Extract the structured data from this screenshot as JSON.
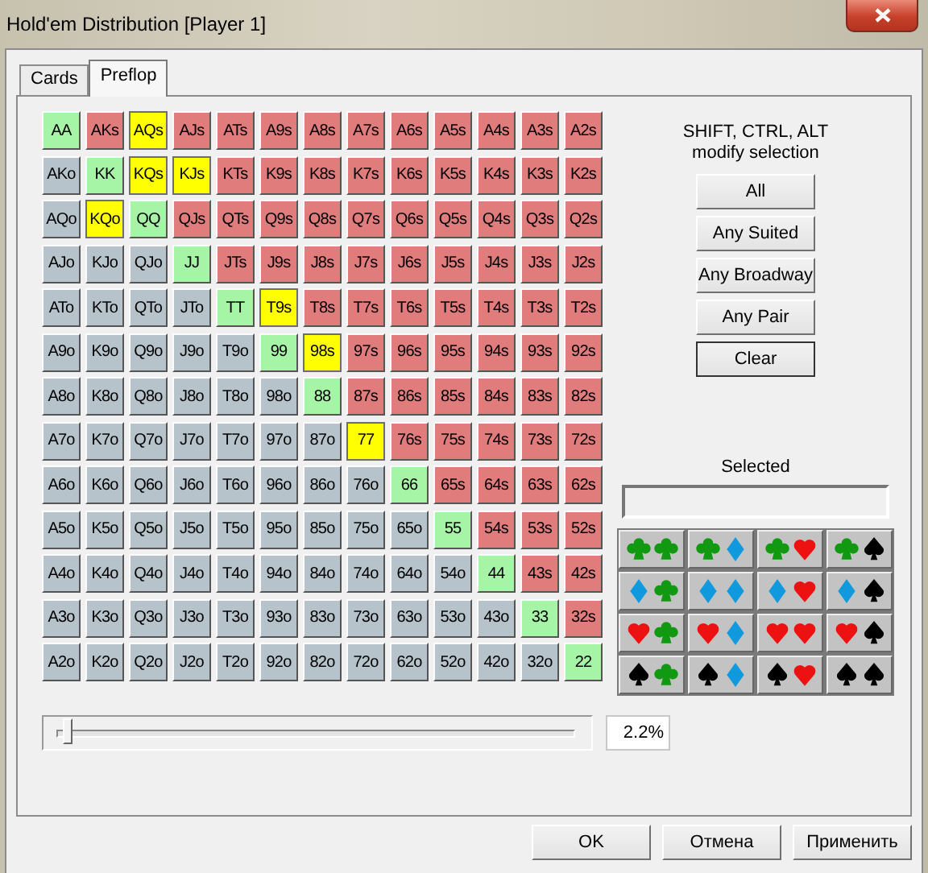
{
  "window": {
    "title": "Hold'em Distribution [Player 1]"
  },
  "tabs": [
    {
      "label": "Cards",
      "selected": false
    },
    {
      "label": "Preflop",
      "selected": true
    }
  ],
  "grid": {
    "rows": [
      [
        {
          "label": "AA",
          "kind": "pair",
          "selected": false
        },
        {
          "label": "AKs",
          "kind": "suited",
          "selected": false
        },
        {
          "label": "AQs",
          "kind": "suited",
          "selected": true
        },
        {
          "label": "AJs",
          "kind": "suited",
          "selected": false
        },
        {
          "label": "ATs",
          "kind": "suited",
          "selected": false
        },
        {
          "label": "A9s",
          "kind": "suited",
          "selected": false
        },
        {
          "label": "A8s",
          "kind": "suited",
          "selected": false
        },
        {
          "label": "A7s",
          "kind": "suited",
          "selected": false
        },
        {
          "label": "A6s",
          "kind": "suited",
          "selected": false
        },
        {
          "label": "A5s",
          "kind": "suited",
          "selected": false
        },
        {
          "label": "A4s",
          "kind": "suited",
          "selected": false
        },
        {
          "label": "A3s",
          "kind": "suited",
          "selected": false
        },
        {
          "label": "A2s",
          "kind": "suited",
          "selected": false
        }
      ],
      [
        {
          "label": "AKo",
          "kind": "offsuit",
          "selected": false
        },
        {
          "label": "KK",
          "kind": "pair",
          "selected": false
        },
        {
          "label": "KQs",
          "kind": "suited",
          "selected": true
        },
        {
          "label": "KJs",
          "kind": "suited",
          "selected": true
        },
        {
          "label": "KTs",
          "kind": "suited",
          "selected": false
        },
        {
          "label": "K9s",
          "kind": "suited",
          "selected": false
        },
        {
          "label": "K8s",
          "kind": "suited",
          "selected": false
        },
        {
          "label": "K7s",
          "kind": "suited",
          "selected": false
        },
        {
          "label": "K6s",
          "kind": "suited",
          "selected": false
        },
        {
          "label": "K5s",
          "kind": "suited",
          "selected": false
        },
        {
          "label": "K4s",
          "kind": "suited",
          "selected": false
        },
        {
          "label": "K3s",
          "kind": "suited",
          "selected": false
        },
        {
          "label": "K2s",
          "kind": "suited",
          "selected": false
        }
      ],
      [
        {
          "label": "AQo",
          "kind": "offsuit",
          "selected": false
        },
        {
          "label": "KQo",
          "kind": "offsuit",
          "selected": true
        },
        {
          "label": "QQ",
          "kind": "pair",
          "selected": false
        },
        {
          "label": "QJs",
          "kind": "suited",
          "selected": false
        },
        {
          "label": "QTs",
          "kind": "suited",
          "selected": false
        },
        {
          "label": "Q9s",
          "kind": "suited",
          "selected": false
        },
        {
          "label": "Q8s",
          "kind": "suited",
          "selected": false
        },
        {
          "label": "Q7s",
          "kind": "suited",
          "selected": false
        },
        {
          "label": "Q6s",
          "kind": "suited",
          "selected": false
        },
        {
          "label": "Q5s",
          "kind": "suited",
          "selected": false
        },
        {
          "label": "Q4s",
          "kind": "suited",
          "selected": false
        },
        {
          "label": "Q3s",
          "kind": "suited",
          "selected": false
        },
        {
          "label": "Q2s",
          "kind": "suited",
          "selected": false
        }
      ],
      [
        {
          "label": "AJo",
          "kind": "offsuit",
          "selected": false
        },
        {
          "label": "KJo",
          "kind": "offsuit",
          "selected": false
        },
        {
          "label": "QJo",
          "kind": "offsuit",
          "selected": false
        },
        {
          "label": "JJ",
          "kind": "pair",
          "selected": false
        },
        {
          "label": "JTs",
          "kind": "suited",
          "selected": false
        },
        {
          "label": "J9s",
          "kind": "suited",
          "selected": false
        },
        {
          "label": "J8s",
          "kind": "suited",
          "selected": false
        },
        {
          "label": "J7s",
          "kind": "suited",
          "selected": false
        },
        {
          "label": "J6s",
          "kind": "suited",
          "selected": false
        },
        {
          "label": "J5s",
          "kind": "suited",
          "selected": false
        },
        {
          "label": "J4s",
          "kind": "suited",
          "selected": false
        },
        {
          "label": "J3s",
          "kind": "suited",
          "selected": false
        },
        {
          "label": "J2s",
          "kind": "suited",
          "selected": false
        }
      ],
      [
        {
          "label": "ATo",
          "kind": "offsuit",
          "selected": false
        },
        {
          "label": "KTo",
          "kind": "offsuit",
          "selected": false
        },
        {
          "label": "QTo",
          "kind": "offsuit",
          "selected": false
        },
        {
          "label": "JTo",
          "kind": "offsuit",
          "selected": false
        },
        {
          "label": "TT",
          "kind": "pair",
          "selected": false
        },
        {
          "label": "T9s",
          "kind": "suited",
          "selected": true
        },
        {
          "label": "T8s",
          "kind": "suited",
          "selected": false
        },
        {
          "label": "T7s",
          "kind": "suited",
          "selected": false
        },
        {
          "label": "T6s",
          "kind": "suited",
          "selected": false
        },
        {
          "label": "T5s",
          "kind": "suited",
          "selected": false
        },
        {
          "label": "T4s",
          "kind": "suited",
          "selected": false
        },
        {
          "label": "T3s",
          "kind": "suited",
          "selected": false
        },
        {
          "label": "T2s",
          "kind": "suited",
          "selected": false
        }
      ],
      [
        {
          "label": "A9o",
          "kind": "offsuit",
          "selected": false
        },
        {
          "label": "K9o",
          "kind": "offsuit",
          "selected": false
        },
        {
          "label": "Q9o",
          "kind": "offsuit",
          "selected": false
        },
        {
          "label": "J9o",
          "kind": "offsuit",
          "selected": false
        },
        {
          "label": "T9o",
          "kind": "offsuit",
          "selected": false
        },
        {
          "label": "99",
          "kind": "pair",
          "selected": false
        },
        {
          "label": "98s",
          "kind": "suited",
          "selected": true
        },
        {
          "label": "97s",
          "kind": "suited",
          "selected": false
        },
        {
          "label": "96s",
          "kind": "suited",
          "selected": false
        },
        {
          "label": "95s",
          "kind": "suited",
          "selected": false
        },
        {
          "label": "94s",
          "kind": "suited",
          "selected": false
        },
        {
          "label": "93s",
          "kind": "suited",
          "selected": false
        },
        {
          "label": "92s",
          "kind": "suited",
          "selected": false
        }
      ],
      [
        {
          "label": "A8o",
          "kind": "offsuit",
          "selected": false
        },
        {
          "label": "K8o",
          "kind": "offsuit",
          "selected": false
        },
        {
          "label": "Q8o",
          "kind": "offsuit",
          "selected": false
        },
        {
          "label": "J8o",
          "kind": "offsuit",
          "selected": false
        },
        {
          "label": "T8o",
          "kind": "offsuit",
          "selected": false
        },
        {
          "label": "98o",
          "kind": "offsuit",
          "selected": false
        },
        {
          "label": "88",
          "kind": "pair",
          "selected": false
        },
        {
          "label": "87s",
          "kind": "suited",
          "selected": false
        },
        {
          "label": "86s",
          "kind": "suited",
          "selected": false
        },
        {
          "label": "85s",
          "kind": "suited",
          "selected": false
        },
        {
          "label": "84s",
          "kind": "suited",
          "selected": false
        },
        {
          "label": "83s",
          "kind": "suited",
          "selected": false
        },
        {
          "label": "82s",
          "kind": "suited",
          "selected": false
        }
      ],
      [
        {
          "label": "A7o",
          "kind": "offsuit",
          "selected": false
        },
        {
          "label": "K7o",
          "kind": "offsuit",
          "selected": false
        },
        {
          "label": "Q7o",
          "kind": "offsuit",
          "selected": false
        },
        {
          "label": "J7o",
          "kind": "offsuit",
          "selected": false
        },
        {
          "label": "T7o",
          "kind": "offsuit",
          "selected": false
        },
        {
          "label": "97o",
          "kind": "offsuit",
          "selected": false
        },
        {
          "label": "87o",
          "kind": "offsuit",
          "selected": false
        },
        {
          "label": "77",
          "kind": "pair",
          "selected": true
        },
        {
          "label": "76s",
          "kind": "suited",
          "selected": false
        },
        {
          "label": "75s",
          "kind": "suited",
          "selected": false
        },
        {
          "label": "74s",
          "kind": "suited",
          "selected": false
        },
        {
          "label": "73s",
          "kind": "suited",
          "selected": false
        },
        {
          "label": "72s",
          "kind": "suited",
          "selected": false
        }
      ],
      [
        {
          "label": "A6o",
          "kind": "offsuit",
          "selected": false
        },
        {
          "label": "K6o",
          "kind": "offsuit",
          "selected": false
        },
        {
          "label": "Q6o",
          "kind": "offsuit",
          "selected": false
        },
        {
          "label": "J6o",
          "kind": "offsuit",
          "selected": false
        },
        {
          "label": "T6o",
          "kind": "offsuit",
          "selected": false
        },
        {
          "label": "96o",
          "kind": "offsuit",
          "selected": false
        },
        {
          "label": "86o",
          "kind": "offsuit",
          "selected": false
        },
        {
          "label": "76o",
          "kind": "offsuit",
          "selected": false
        },
        {
          "label": "66",
          "kind": "pair",
          "selected": false
        },
        {
          "label": "65s",
          "kind": "suited",
          "selected": false
        },
        {
          "label": "64s",
          "kind": "suited",
          "selected": false
        },
        {
          "label": "63s",
          "kind": "suited",
          "selected": false
        },
        {
          "label": "62s",
          "kind": "suited",
          "selected": false
        }
      ],
      [
        {
          "label": "A5o",
          "kind": "offsuit",
          "selected": false
        },
        {
          "label": "K5o",
          "kind": "offsuit",
          "selected": false
        },
        {
          "label": "Q5o",
          "kind": "offsuit",
          "selected": false
        },
        {
          "label": "J5o",
          "kind": "offsuit",
          "selected": false
        },
        {
          "label": "T5o",
          "kind": "offsuit",
          "selected": false
        },
        {
          "label": "95o",
          "kind": "offsuit",
          "selected": false
        },
        {
          "label": "85o",
          "kind": "offsuit",
          "selected": false
        },
        {
          "label": "75o",
          "kind": "offsuit",
          "selected": false
        },
        {
          "label": "65o",
          "kind": "offsuit",
          "selected": false
        },
        {
          "label": "55",
          "kind": "pair",
          "selected": false
        },
        {
          "label": "54s",
          "kind": "suited",
          "selected": false
        },
        {
          "label": "53s",
          "kind": "suited",
          "selected": false
        },
        {
          "label": "52s",
          "kind": "suited",
          "selected": false
        }
      ],
      [
        {
          "label": "A4o",
          "kind": "offsuit",
          "selected": false
        },
        {
          "label": "K4o",
          "kind": "offsuit",
          "selected": false
        },
        {
          "label": "Q4o",
          "kind": "offsuit",
          "selected": false
        },
        {
          "label": "J4o",
          "kind": "offsuit",
          "selected": false
        },
        {
          "label": "T4o",
          "kind": "offsuit",
          "selected": false
        },
        {
          "label": "94o",
          "kind": "offsuit",
          "selected": false
        },
        {
          "label": "84o",
          "kind": "offsuit",
          "selected": false
        },
        {
          "label": "74o",
          "kind": "offsuit",
          "selected": false
        },
        {
          "label": "64o",
          "kind": "offsuit",
          "selected": false
        },
        {
          "label": "54o",
          "kind": "offsuit",
          "selected": false
        },
        {
          "label": "44",
          "kind": "pair",
          "selected": false
        },
        {
          "label": "43s",
          "kind": "suited",
          "selected": false
        },
        {
          "label": "42s",
          "kind": "suited",
          "selected": false
        }
      ],
      [
        {
          "label": "A3o",
          "kind": "offsuit",
          "selected": false
        },
        {
          "label": "K3o",
          "kind": "offsuit",
          "selected": false
        },
        {
          "label": "Q3o",
          "kind": "offsuit",
          "selected": false
        },
        {
          "label": "J3o",
          "kind": "offsuit",
          "selected": false
        },
        {
          "label": "T3o",
          "kind": "offsuit",
          "selected": false
        },
        {
          "label": "93o",
          "kind": "offsuit",
          "selected": false
        },
        {
          "label": "83o",
          "kind": "offsuit",
          "selected": false
        },
        {
          "label": "73o",
          "kind": "offsuit",
          "selected": false
        },
        {
          "label": "63o",
          "kind": "offsuit",
          "selected": false
        },
        {
          "label": "53o",
          "kind": "offsuit",
          "selected": false
        },
        {
          "label": "43o",
          "kind": "offsuit",
          "selected": false
        },
        {
          "label": "33",
          "kind": "pair",
          "selected": false
        },
        {
          "label": "32s",
          "kind": "suited",
          "selected": false
        }
      ],
      [
        {
          "label": "A2o",
          "kind": "offsuit",
          "selected": false
        },
        {
          "label": "K2o",
          "kind": "offsuit",
          "selected": false
        },
        {
          "label": "Q2o",
          "kind": "offsuit",
          "selected": false
        },
        {
          "label": "J2o",
          "kind": "offsuit",
          "selected": false
        },
        {
          "label": "T2o",
          "kind": "offsuit",
          "selected": false
        },
        {
          "label": "92o",
          "kind": "offsuit",
          "selected": false
        },
        {
          "label": "82o",
          "kind": "offsuit",
          "selected": false
        },
        {
          "label": "72o",
          "kind": "offsuit",
          "selected": false
        },
        {
          "label": "62o",
          "kind": "offsuit",
          "selected": false
        },
        {
          "label": "52o",
          "kind": "offsuit",
          "selected": false
        },
        {
          "label": "42o",
          "kind": "offsuit",
          "selected": false
        },
        {
          "label": "32o",
          "kind": "offsuit",
          "selected": false
        },
        {
          "label": "22",
          "kind": "pair",
          "selected": false
        }
      ]
    ]
  },
  "hint": [
    "SHIFT, CTRL, ALT",
    "modify selection"
  ],
  "buttons": [
    "All",
    "Any Suited",
    "Any Broadway",
    "Any Pair",
    "Clear"
  ],
  "selected_label": "Selected",
  "suit_combos": [
    [
      {
        "kind": "club-club"
      },
      {
        "kind": "club-diamond"
      },
      {
        "kind": "club-heart"
      },
      {
        "kind": "club-spade"
      }
    ],
    [
      {
        "kind": "diamond-club"
      },
      {
        "kind": "diamond-diamond"
      },
      {
        "kind": "diamond-heart"
      },
      {
        "kind": "diamond-spade"
      }
    ],
    [
      {
        "kind": "heart-club"
      },
      {
        "kind": "heart-diamond"
      },
      {
        "kind": "heart-heart"
      },
      {
        "kind": "heart-spade"
      }
    ],
    [
      {
        "kind": "spade-club"
      },
      {
        "kind": "spade-diamond"
      },
      {
        "kind": "spade-heart"
      },
      {
        "kind": "spade-spade"
      }
    ]
  ],
  "slider": {
    "level": 0.02,
    "reading": "2.2%"
  },
  "footer_buttons": [
    "OK",
    "Отмена",
    "Применить"
  ]
}
